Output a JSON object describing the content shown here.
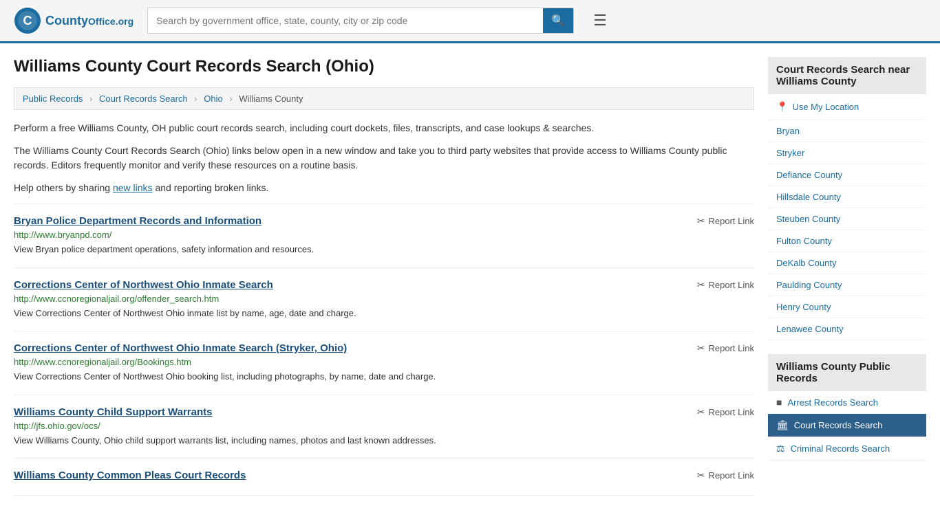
{
  "header": {
    "logo_text": "County",
    "logo_org": "Office",
    "logo_tld": ".org",
    "search_placeholder": "Search by government office, state, county, city or zip code",
    "search_button_icon": "🔍"
  },
  "page": {
    "title": "Williams County Court Records Search (Ohio)"
  },
  "breadcrumb": {
    "items": [
      "Public Records",
      "Court Records Search",
      "Ohio",
      "Williams County"
    ]
  },
  "description": {
    "para1": "Perform a free Williams County, OH public court records search, including court dockets, files, transcripts, and case lookups & searches.",
    "para2": "The Williams County Court Records Search (Ohio) links below open in a new window and take you to third party websites that provide access to Williams County public records. Editors frequently monitor and verify these resources on a routine basis.",
    "para3_prefix": "Help others by sharing ",
    "para3_link": "new links",
    "para3_suffix": " and reporting broken links."
  },
  "records": [
    {
      "title": "Bryan Police Department Records and Information",
      "url": "http://www.bryanpd.com/",
      "description": "View Bryan police department operations, safety information and resources."
    },
    {
      "title": "Corrections Center of Northwest Ohio Inmate Search",
      "url": "http://www.ccnoregionaljail.org/offender_search.htm",
      "description": "View Corrections Center of Northwest Ohio inmate list by name, age, date and charge."
    },
    {
      "title": "Corrections Center of Northwest Ohio Inmate Search (Stryker, Ohio)",
      "url": "http://www.ccnoregionaljail.org/Bookings.htm",
      "description": "View Corrections Center of Northwest Ohio booking list, including photographs, by name, date and charge."
    },
    {
      "title": "Williams County Child Support Warrants",
      "url": "http://jfs.ohio.gov/ocs/",
      "description": "View Williams County, Ohio child support warrants list, including names, photos and last known addresses."
    },
    {
      "title": "Williams County Common Pleas Court Records",
      "url": "",
      "description": ""
    }
  ],
  "report_link_label": "Report Link",
  "sidebar": {
    "nearby_header": "Court Records Search near Williams County",
    "use_my_location": "Use My Location",
    "nearby_links": [
      "Bryan",
      "Stryker",
      "Defiance County",
      "Hillsdale County",
      "Steuben County",
      "Fulton County",
      "DeKalb County",
      "Paulding County",
      "Henry County",
      "Lenawee County"
    ],
    "public_records_header": "Williams County Public Records",
    "public_records_links": [
      {
        "label": "Arrest Records Search",
        "icon": "■",
        "active": false
      },
      {
        "label": "Court Records Search",
        "icon": "🏛",
        "active": true
      },
      {
        "label": "Criminal Records Search",
        "icon": "⚖",
        "active": false
      }
    ]
  }
}
